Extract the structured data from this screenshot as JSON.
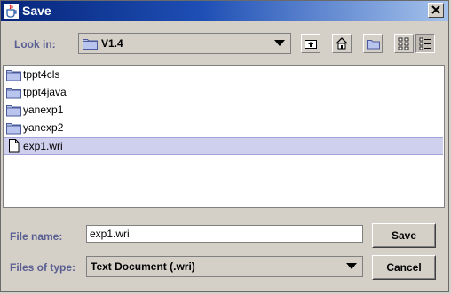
{
  "window": {
    "title": "Save"
  },
  "look_in": {
    "label": "Look in:",
    "value": "V1.4"
  },
  "toolbar": {
    "up_icon": "up-folder-icon",
    "home_icon": "home-icon",
    "new_folder_icon": "new-folder-icon",
    "list_view_icon": "list-view-icon",
    "details_view_icon": "details-view-icon"
  },
  "files": [
    {
      "name": "tppt4cls",
      "type": "folder",
      "selected": false
    },
    {
      "name": "tppt4java",
      "type": "folder",
      "selected": false
    },
    {
      "name": "yanexp1",
      "type": "folder",
      "selected": false
    },
    {
      "name": "yanexp2",
      "type": "folder",
      "selected": false
    },
    {
      "name": "exp1.wri",
      "type": "file",
      "selected": true
    }
  ],
  "file_name": {
    "label": "File name:",
    "value": "exp1.wri"
  },
  "files_of_type": {
    "label": "Files of type:",
    "value": "Text Document (.wri)"
  },
  "buttons": {
    "save": "Save",
    "cancel": "Cancel"
  },
  "colors": {
    "label_blue": "#5a5f92",
    "selection": "#cfcfee",
    "title_bar": "#06257a"
  }
}
